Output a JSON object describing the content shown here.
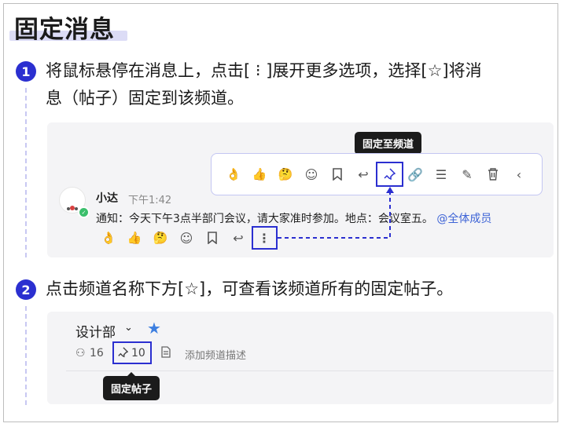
{
  "title": "固定消息",
  "step1": {
    "number": "1",
    "line1": "将鼠标悬停在消息上，点击[ ⁝ ]展开更多选项，选择[☆]将消",
    "line2": "息（帖子）固定到该频道。"
  },
  "step2": {
    "number": "2",
    "text": "点击频道名称下方[☆]，可查看该频道所有的固定帖子。"
  },
  "message_card": {
    "tooltip": "固定至频道",
    "sender": "小达",
    "time": "下午1:42",
    "text": "通知：今天下午3点半部门会议，请大家准时参加。地点：会议室五。",
    "mention": "@全体成员",
    "toolbar_icons": [
      "ok-hand-emoji",
      "thumbs-up-emoji",
      "thinking-emoji",
      "add-reaction-icon",
      "bookmark-icon",
      "reply-icon",
      "pin-icon",
      "link-icon",
      "list-icon",
      "edit-icon",
      "delete-icon",
      "collapse-icon"
    ],
    "reaction_icons": [
      "ok-hand-emoji",
      "thumbs-up-emoji",
      "thinking-emoji",
      "add-reaction-icon",
      "bookmark-icon",
      "reply-icon",
      "more-icon"
    ]
  },
  "channel_card": {
    "name": "设计部",
    "member_count": "16",
    "pinned_count": "10",
    "add_description": "添加频道描述",
    "tooltip": "固定帖子"
  },
  "colors": {
    "accent": "#2b2fd0",
    "star": "#3d7fe0",
    "mention": "#3d63d6",
    "card_bg": "#f4f4f6"
  }
}
